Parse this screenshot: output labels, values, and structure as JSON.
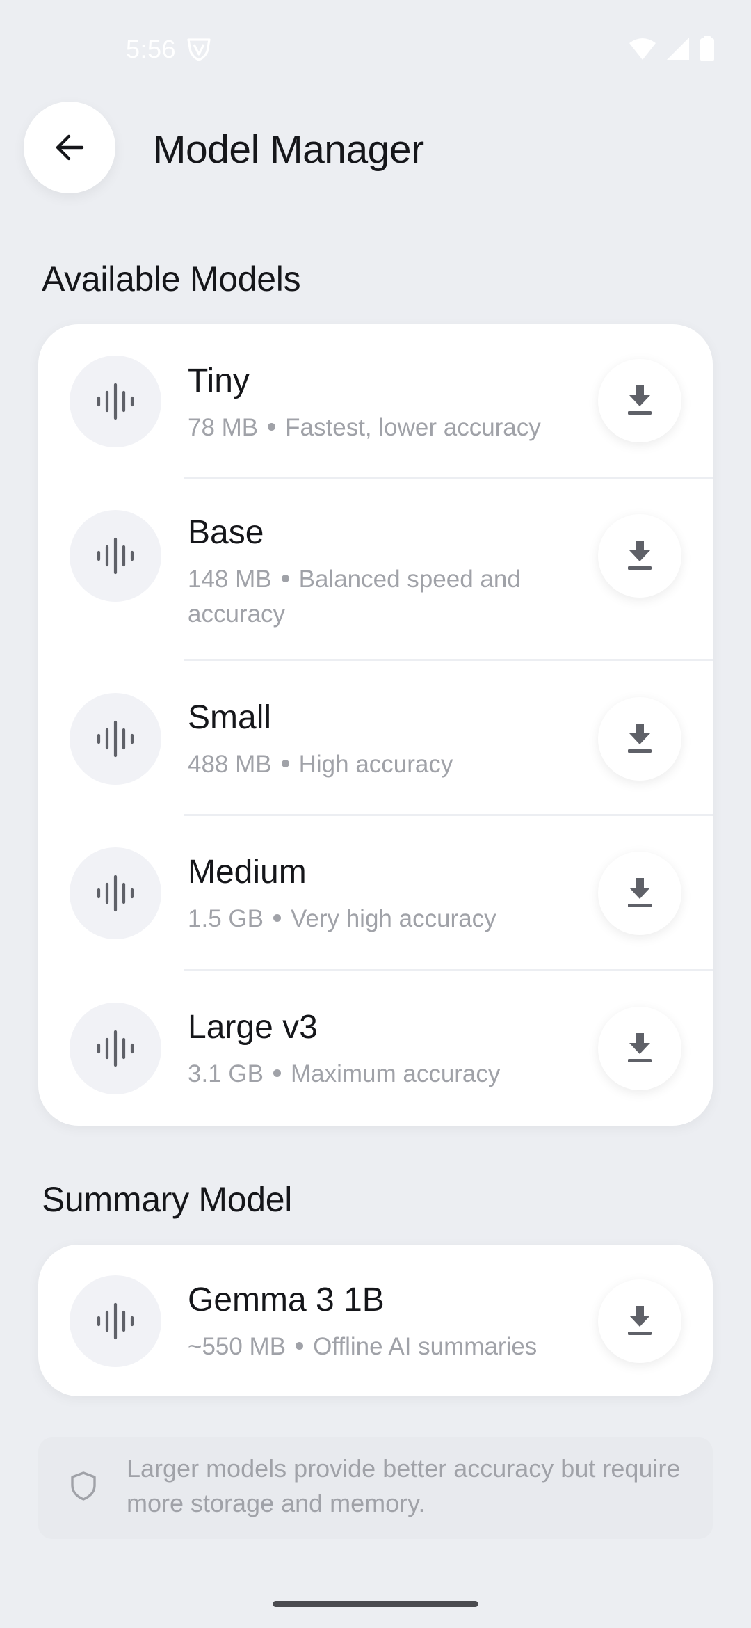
{
  "status_bar": {
    "time": "5:56",
    "vpn_icon": "vpn-key-shield-icon",
    "wifi_icon": "wifi-icon",
    "signal_icon": "cell-signal-icon",
    "battery_icon": "battery-icon"
  },
  "header": {
    "back_icon": "arrow-left-icon",
    "title": "Model Manager"
  },
  "available": {
    "section_title": "Available Models",
    "items": [
      {
        "name": "Tiny",
        "size": "78 MB",
        "description": "Fastest, lower accuracy",
        "icon": "audio-waveform-icon",
        "action_icon": "download-icon"
      },
      {
        "name": "Base",
        "size": "148 MB",
        "description": "Balanced speed and accuracy",
        "icon": "audio-waveform-icon",
        "action_icon": "download-icon"
      },
      {
        "name": "Small",
        "size": "488 MB",
        "description": "High accuracy",
        "icon": "audio-waveform-icon",
        "action_icon": "download-icon"
      },
      {
        "name": "Medium",
        "size": "1.5 GB",
        "description": "Very high accuracy",
        "icon": "audio-waveform-icon",
        "action_icon": "download-icon"
      },
      {
        "name": "Large v3",
        "size": "3.1 GB",
        "description": "Maximum accuracy",
        "icon": "audio-waveform-icon",
        "action_icon": "download-icon"
      }
    ]
  },
  "summary": {
    "section_title": "Summary Model",
    "items": [
      {
        "name": "Gemma 3 1B",
        "size": "~550 MB",
        "description": "Offline AI summaries",
        "icon": "audio-waveform-icon",
        "action_icon": "download-icon"
      }
    ]
  },
  "info": {
    "icon": "shield-icon",
    "text": "Larger models provide better accuracy but require more storage and memory."
  },
  "colors": {
    "background": "#eceef2",
    "card": "#ffffff",
    "primary_text": "#15161a",
    "secondary_text": "#a0a2a8",
    "icon_gray": "#5f6168"
  }
}
